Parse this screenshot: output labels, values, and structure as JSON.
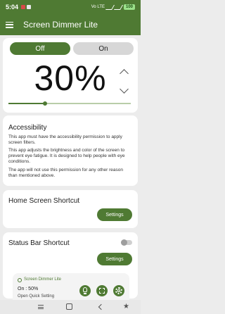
{
  "status_bar": {
    "time": "5:04",
    "network": "Vo LTE",
    "battery": "100",
    "icons": [
      "notification-icon",
      "photo-icon",
      "signal-icon",
      "wifi-icon",
      "battery-icon"
    ]
  },
  "app_bar": {
    "title": "Screen Dimmer Lite",
    "menu_icon": "hamburger-icon"
  },
  "dimmer": {
    "off_label": "Off",
    "on_label": "On",
    "percent": "30%",
    "slider_value": 0.3
  },
  "accessibility": {
    "title": "Accessibility",
    "p1": "This app must have the accessibility permission to apply screen filters.",
    "p2": "This app adjusts the brightness and color of the screen to prevent eye fatigue. It is designed to help people with eye conditions.",
    "p3": "The app will not use this permission for any other reason than mentioned above."
  },
  "home_shortcut": {
    "title": "Home Screen Shortcut",
    "button": "Settings"
  },
  "status_bar_shortcut": {
    "title": "Status Bar Shortcut",
    "toggle_on": false,
    "button": "Settings",
    "notification": {
      "app_name": "Screen Dimmer Lite",
      "status": "On : 50%",
      "subtitle": "Open Quick Setting"
    }
  },
  "nav_bar": {
    "icons": [
      "recent-apps-icon",
      "home-icon",
      "back-icon",
      "accessibility-icon"
    ]
  },
  "colors": {
    "accent": "#4f7a33",
    "background": "#ececec",
    "card": "#ffffff"
  }
}
